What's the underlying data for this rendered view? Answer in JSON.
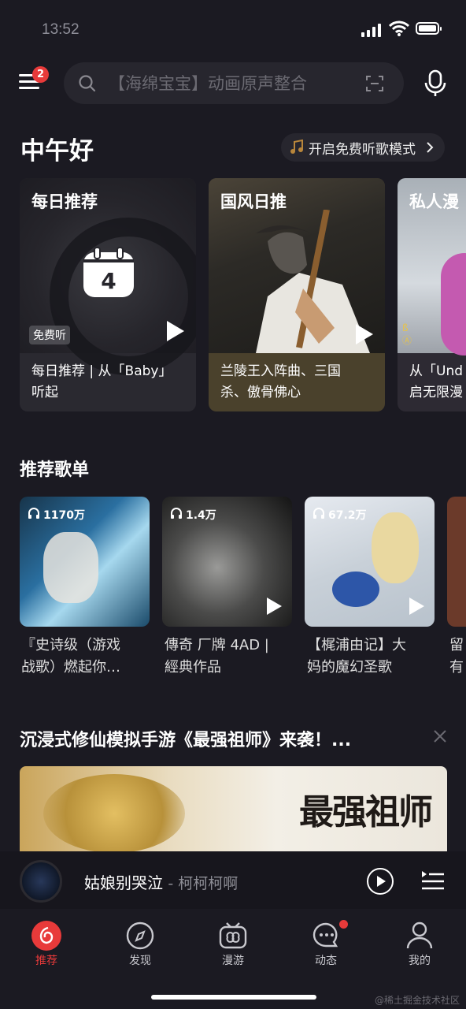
{
  "status_bar": {
    "time": "13:52"
  },
  "header": {
    "menu_badge": "2",
    "search_placeholder": "【海绵宝宝】动画原声整合"
  },
  "greeting": "中午好",
  "free_mode_label": "开启免费听歌模式",
  "feature_cards": [
    {
      "title": "每日推荐",
      "date": "4",
      "tag": "免费听",
      "caption": [
        "每日推荐 | 从「Baby」",
        "听起"
      ]
    },
    {
      "title": "国风日推",
      "caption": [
        "兰陵王入阵曲、三国",
        "杀、傲骨佛心"
      ]
    },
    {
      "title": "私人漫",
      "caption": [
        "从「Und",
        "启无限漫"
      ]
    }
  ],
  "playlists_section": {
    "title": "推荐歌单",
    "items": [
      {
        "count": "1170万",
        "name": [
          "『史诗级（游戏",
          "战歌）燃起你…"
        ]
      },
      {
        "count": "1.4万",
        "name": [
          "傳奇 厂牌 4AD |",
          "經典作品"
        ]
      },
      {
        "count": "67.2万",
        "name": [
          "【梶浦由记】大",
          "妈的魔幻圣歌"
        ]
      },
      {
        "count": "",
        "name": [
          "留",
          "有"
        ]
      }
    ]
  },
  "ad_section": {
    "title": "沉浸式修仙模拟手游《最强祖师》来袭！...",
    "banner_logo": "最强祖师"
  },
  "mini_player": {
    "song": "姑娘别哭泣",
    "artist": "- 柯柯柯啊"
  },
  "tabs": [
    {
      "label": "推荐",
      "icon": "netease-icon",
      "active": true
    },
    {
      "label": "发现",
      "icon": "compass-icon",
      "active": false
    },
    {
      "label": "漫游",
      "icon": "radio-icon",
      "active": false
    },
    {
      "label": "动态",
      "icon": "chat-icon",
      "active": false
    },
    {
      "label": "我的",
      "icon": "user-icon",
      "active": false
    }
  ],
  "watermark": "@稀土掘金技术社区",
  "colors": {
    "background": "#1b1a22",
    "accent": "#e83a3a",
    "surface": "#27262e"
  }
}
